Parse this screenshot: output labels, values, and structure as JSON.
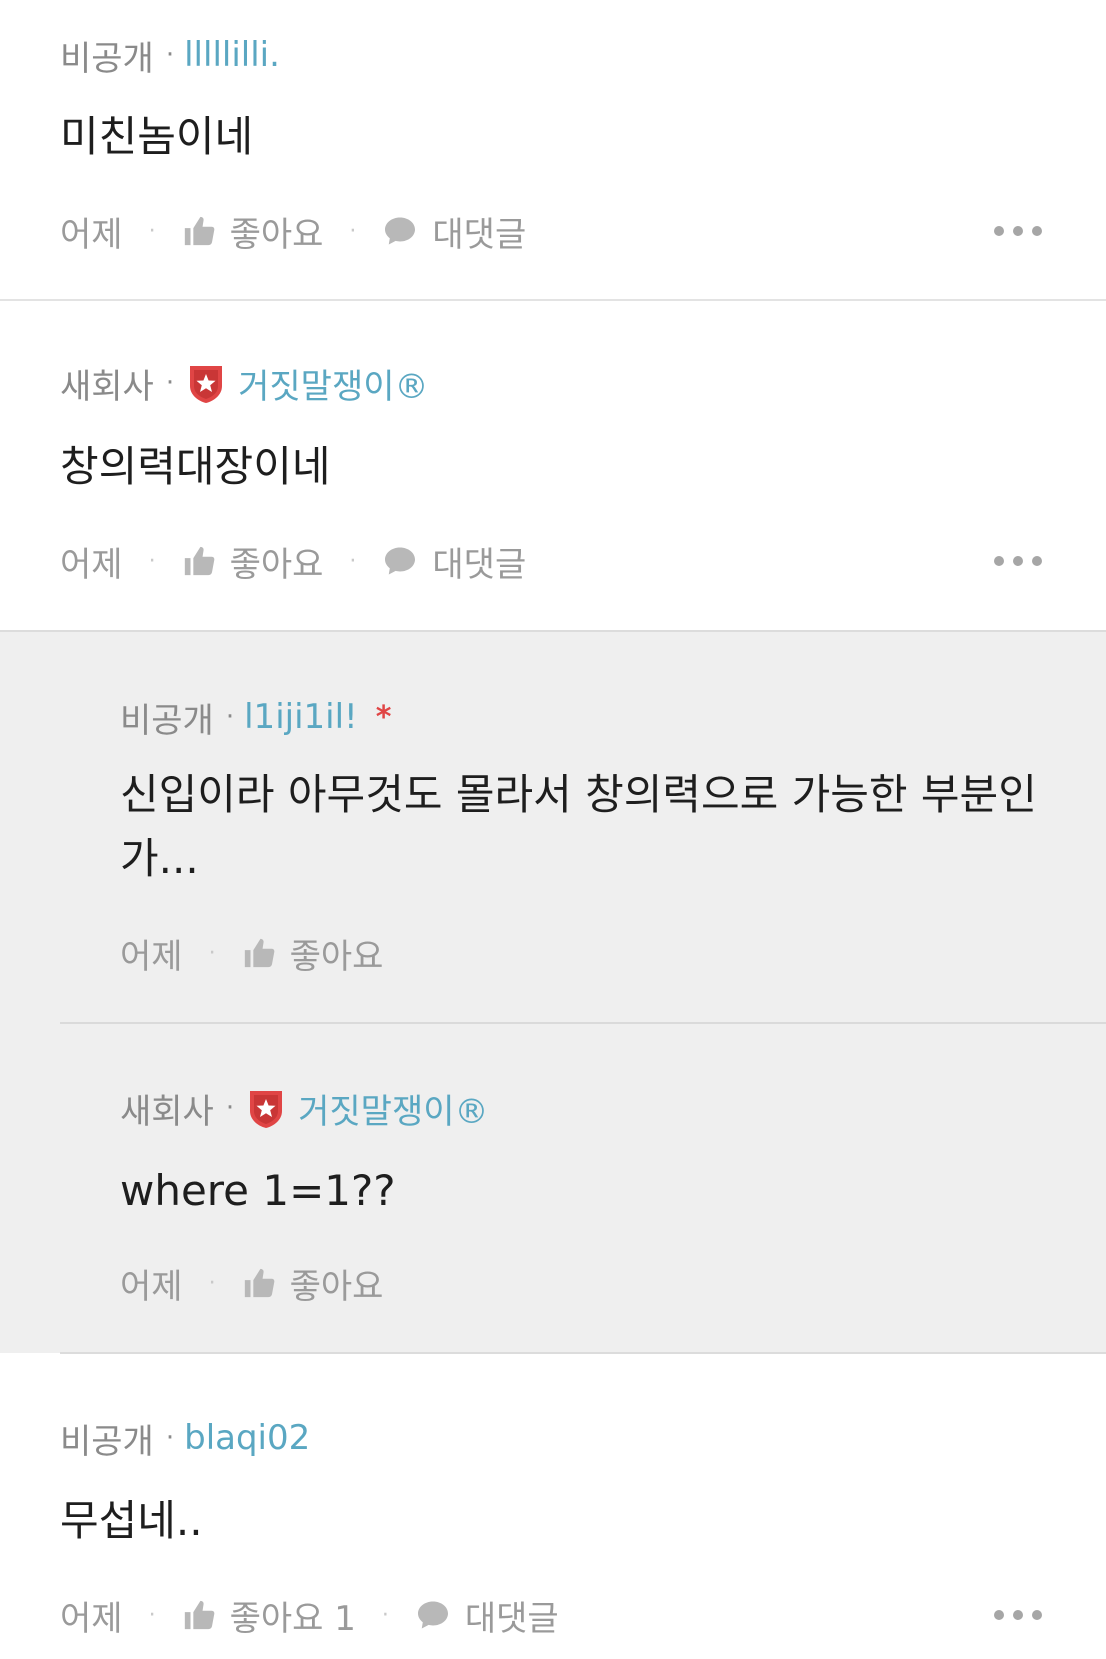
{
  "comments": [
    {
      "company": "비공개",
      "username": "lllllilli.",
      "text": "미친놈이네",
      "time": "어제",
      "like_label": "좋아요",
      "reply_label": "대댓글"
    },
    {
      "company": "새회사",
      "username": "거짓말쟁이®",
      "text": "창의력대장이네",
      "time": "어제",
      "like_label": "좋아요",
      "reply_label": "대댓글"
    },
    {
      "company": "비공개",
      "username": "blaqi02",
      "text": "무섭네..",
      "time": "어제",
      "like_label": "좋아요 1",
      "reply_label": "대댓글"
    }
  ],
  "replies": [
    {
      "company": "비공개",
      "username": "l1iji1il!",
      "author_mark": "*",
      "text_line1": "신입이라 아무것도 몰라서 창의력으로 가능한 부분인",
      "text_line2": "가...",
      "time": "어제",
      "like_label": "좋아요"
    },
    {
      "company": "새회사",
      "username": "거짓말쟁이®",
      "text": "where 1=1??",
      "time": "어제",
      "like_label": "좋아요"
    }
  ],
  "colors": {
    "username": "#5aa7c2",
    "badge": "#e04545",
    "reply_background": "#efefef",
    "muted_text": "#9a9a9a"
  },
  "icons": {
    "like": "thumbs-up-icon",
    "reply": "speech-bubble-icon",
    "more": "more-dots-icon",
    "badge": "shield-star-badge-icon"
  }
}
